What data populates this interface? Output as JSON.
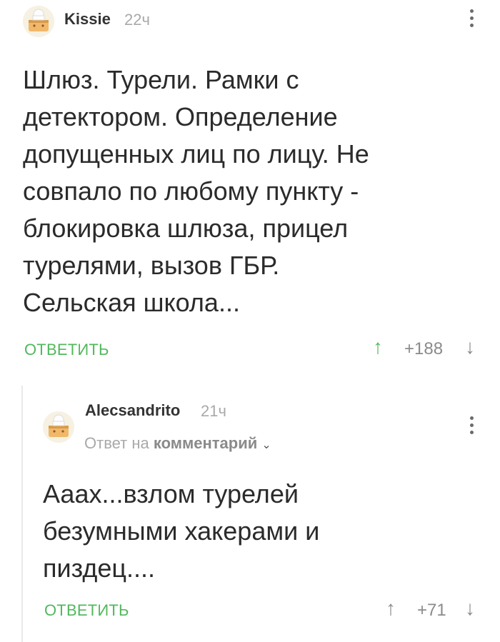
{
  "comments": [
    {
      "author": "Kissie",
      "time": "22ч",
      "text": "Шлюз. Турели. Рамки с детектором. Определение допущенных лиц по лицу. Не совпало по любому пункту - блокировка шлюза, прицел турелями, вызов ГБР. Сельская школа...",
      "reply_label": "ОТВЕТИТЬ",
      "rating": "+188",
      "icons": {
        "upvote": "arrow-up",
        "downvote": "arrow-down",
        "menu": "more-vertical"
      }
    },
    {
      "author": "Alecsandrito",
      "time": "21ч",
      "reply_to_prefix": "Ответ на",
      "reply_to_link": "комментарий",
      "text": "Аааx...взлом турелей безумными хакерами и пиздец....",
      "reply_label": "ОТВЕТИТЬ",
      "rating": "+71",
      "icons": {
        "upvote": "arrow-up",
        "downvote": "arrow-down",
        "menu": "more-vertical"
      }
    }
  ],
  "colors": {
    "accent": "#52b85d",
    "muted": "#a9a9a9",
    "text": "#2b2b2b"
  }
}
